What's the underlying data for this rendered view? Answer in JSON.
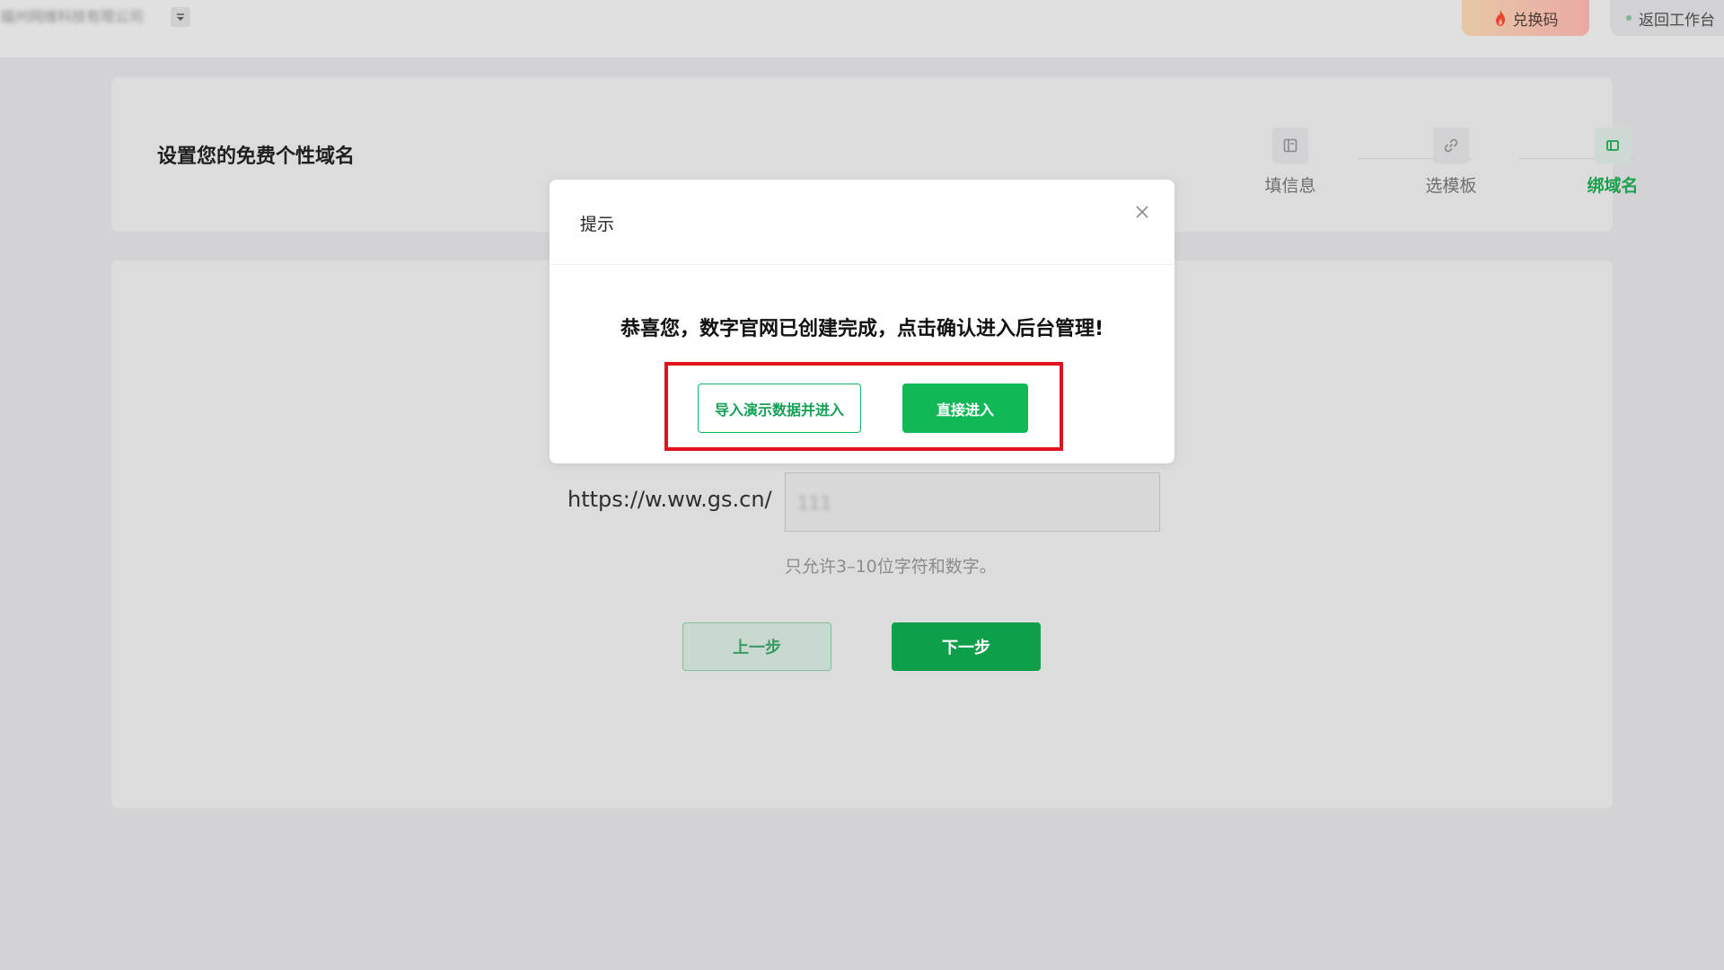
{
  "topbar": {
    "company_name": "福州网维科技有限公司",
    "redeem_label": "兑换码",
    "back_label": "返回工作台"
  },
  "header": {
    "title": "设置您的免费个性域名",
    "steps": [
      {
        "label": "填信息",
        "icon": "form-icon",
        "active": false
      },
      {
        "label": "选模板",
        "icon": "link-icon",
        "active": false
      },
      {
        "label": "绑域名",
        "icon": "layout-icon",
        "active": true
      }
    ]
  },
  "main": {
    "domain_prefix": "https://w.ww.gs.cn/",
    "domain_value": "111",
    "hint": "只允许3–10位字符和数字。",
    "prev_label": "上一步",
    "next_label": "下一步"
  },
  "modal": {
    "title": "提示",
    "message": "恭喜您，数字官网已创建完成，点击确认进入后台管理!",
    "import_label": "导入演示数据并进入",
    "enter_label": "直接进入"
  },
  "colors": {
    "accent": "#12b857",
    "highlight": "#e0141e"
  }
}
